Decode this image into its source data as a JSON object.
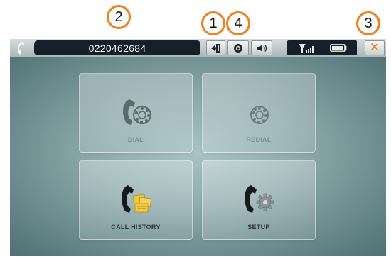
{
  "callouts": [
    "2",
    "1",
    "4",
    "3"
  ],
  "topbar": {
    "phone_number": "0220462684",
    "close_symbol": "✕",
    "icons": {
      "handset": "handset-icon",
      "transfer": "transfer-icon",
      "record": "record-icon",
      "volume": "speaker-icon",
      "signal": "signal-strength-icon",
      "battery": "battery-icon",
      "close": "close-icon"
    }
  },
  "menu": {
    "tiles": [
      {
        "label": "DIAL",
        "icon": "dial-phone-icon"
      },
      {
        "label": "REDIAL",
        "icon": "redial-rotary-icon"
      },
      {
        "label": "CALL HISTORY",
        "icon": "call-history-icon"
      },
      {
        "label": "SETUP",
        "icon": "setup-gear-phone-icon"
      }
    ]
  },
  "colors": {
    "accent": "#f0801e",
    "field_bg": "#15202a",
    "screen_bg": "#8eaaac"
  }
}
